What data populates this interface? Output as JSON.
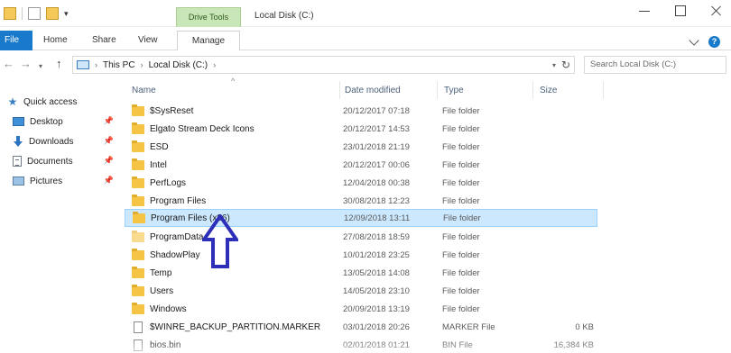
{
  "window": {
    "contextual_tab_group": "Drive Tools",
    "title": "Local Disk (C:)"
  },
  "ribbon": {
    "tabs": [
      "File",
      "Home",
      "Share",
      "View",
      "Manage"
    ]
  },
  "address": {
    "crumbs": [
      "This PC",
      "Local Disk (C:)"
    ],
    "search_placeholder": "Search Local Disk (C:)"
  },
  "nav_pane": {
    "quick_access": "Quick access",
    "items": [
      {
        "label": "Desktop",
        "icon": "desktop-icon",
        "pinned": true
      },
      {
        "label": "Downloads",
        "icon": "downloads-icon",
        "pinned": true
      },
      {
        "label": "Documents",
        "icon": "documents-icon",
        "pinned": true
      },
      {
        "label": "Pictures",
        "icon": "pictures-icon",
        "pinned": true
      }
    ]
  },
  "columns": {
    "name": "Name",
    "date": "Date modified",
    "type": "Type",
    "size": "Size"
  },
  "files": [
    {
      "name": "$SysReset",
      "date": "20/12/2017 07:18",
      "type": "File folder",
      "size": "",
      "kind": "folder"
    },
    {
      "name": "Elgato Stream Deck Icons",
      "date": "20/12/2017 14:53",
      "type": "File folder",
      "size": "",
      "kind": "folder"
    },
    {
      "name": "ESD",
      "date": "23/01/2018 21:19",
      "type": "File folder",
      "size": "",
      "kind": "folder"
    },
    {
      "name": "Intel",
      "date": "20/12/2017 00:06",
      "type": "File folder",
      "size": "",
      "kind": "folder"
    },
    {
      "name": "PerfLogs",
      "date": "12/04/2018 00:38",
      "type": "File folder",
      "size": "",
      "kind": "folder"
    },
    {
      "name": "Program Files",
      "date": "30/08/2018 12:23",
      "type": "File folder",
      "size": "",
      "kind": "folder"
    },
    {
      "name": "Program Files (x86)",
      "date": "12/09/2018 13:11",
      "type": "File folder",
      "size": "",
      "kind": "folder",
      "selected": true
    },
    {
      "name": "ProgramData",
      "date": "27/08/2018 18:59",
      "type": "File folder",
      "size": "",
      "kind": "folder"
    },
    {
      "name": "ShadowPlay",
      "date": "10/01/2018 23:25",
      "type": "File folder",
      "size": "",
      "kind": "folder"
    },
    {
      "name": "Temp",
      "date": "13/05/2018 14:08",
      "type": "File folder",
      "size": "",
      "kind": "folder"
    },
    {
      "name": "Users",
      "date": "14/05/2018 23:10",
      "type": "File folder",
      "size": "",
      "kind": "folder"
    },
    {
      "name": "Windows",
      "date": "20/09/2018 13:19",
      "type": "File folder",
      "size": "",
      "kind": "folder"
    },
    {
      "name": "$WINRE_BACKUP_PARTITION.MARKER",
      "date": "03/01/2018 20:26",
      "type": "MARKER File",
      "size": "0 KB",
      "kind": "file"
    },
    {
      "name": "bios.bin",
      "date": "02/01/2018 01:21",
      "type": "BIN File",
      "size": "16,384 KB",
      "kind": "file"
    }
  ],
  "colors": {
    "file_tab": "#1979ca",
    "context_tab": "#c9e6b8",
    "selection": "#cce8ff",
    "annotation_arrow": "#2e2fb8",
    "folder": "#f5c445"
  }
}
